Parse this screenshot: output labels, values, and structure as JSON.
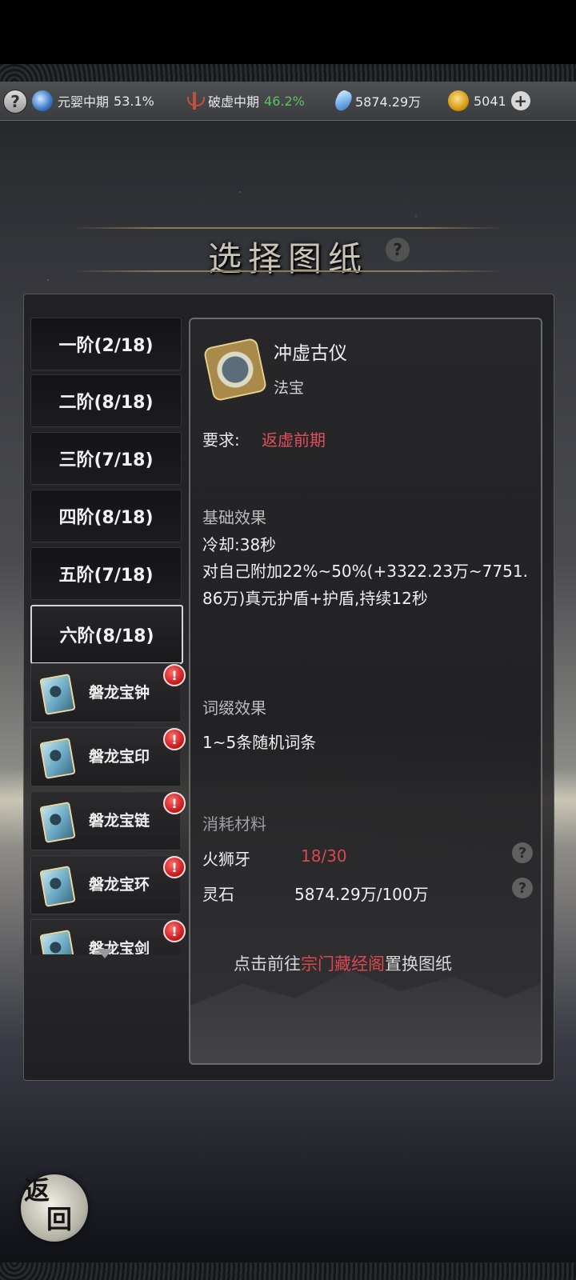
{
  "topbar": {
    "realm1": {
      "name": "元婴中期",
      "percent": "53.1%"
    },
    "realm2": {
      "name": "破虚中期",
      "percent": "46.2%"
    },
    "spirit_stones": "5874.29万",
    "coins": "5041"
  },
  "title": "选择图纸",
  "tiers": [
    {
      "label": "一阶(2/18)"
    },
    {
      "label": "二阶(8/18)"
    },
    {
      "label": "三阶(7/18)"
    },
    {
      "label": "四阶(8/18)"
    },
    {
      "label": "五阶(7/18)"
    },
    {
      "label": "六阶(8/18)"
    }
  ],
  "items": [
    {
      "label": "磐龙宝钟"
    },
    {
      "label": "磐龙宝印"
    },
    {
      "label": "磐龙宝链"
    },
    {
      "label": "磐龙宝环"
    },
    {
      "label": "磐龙宝剑"
    }
  ],
  "detail": {
    "name": "冲虚古仪",
    "type": "法宝",
    "requirement_label": "要求:",
    "requirement_value": "返虚前期",
    "base_title": "基础效果",
    "cooldown": "冷却:38秒",
    "effect": "对自己附加22%~50%(+3322.23万~7751.86万)真元护盾+护盾,持续12秒",
    "affix_title": "词缀效果",
    "affix_text": "1~5条随机词条",
    "materials_title": "消耗材料",
    "materials": [
      {
        "name": "火狮牙",
        "value": "18/30"
      },
      {
        "name": "灵石",
        "value": "5874.29万/100万"
      }
    ],
    "goto_prefix": "点击前往",
    "goto_link": "宗门藏经阁",
    "goto_suffix": "置换图纸"
  },
  "back_label": [
    "返",
    "回"
  ],
  "colors": {
    "accent_red": "#d8484f",
    "green": "#5fc15f"
  }
}
